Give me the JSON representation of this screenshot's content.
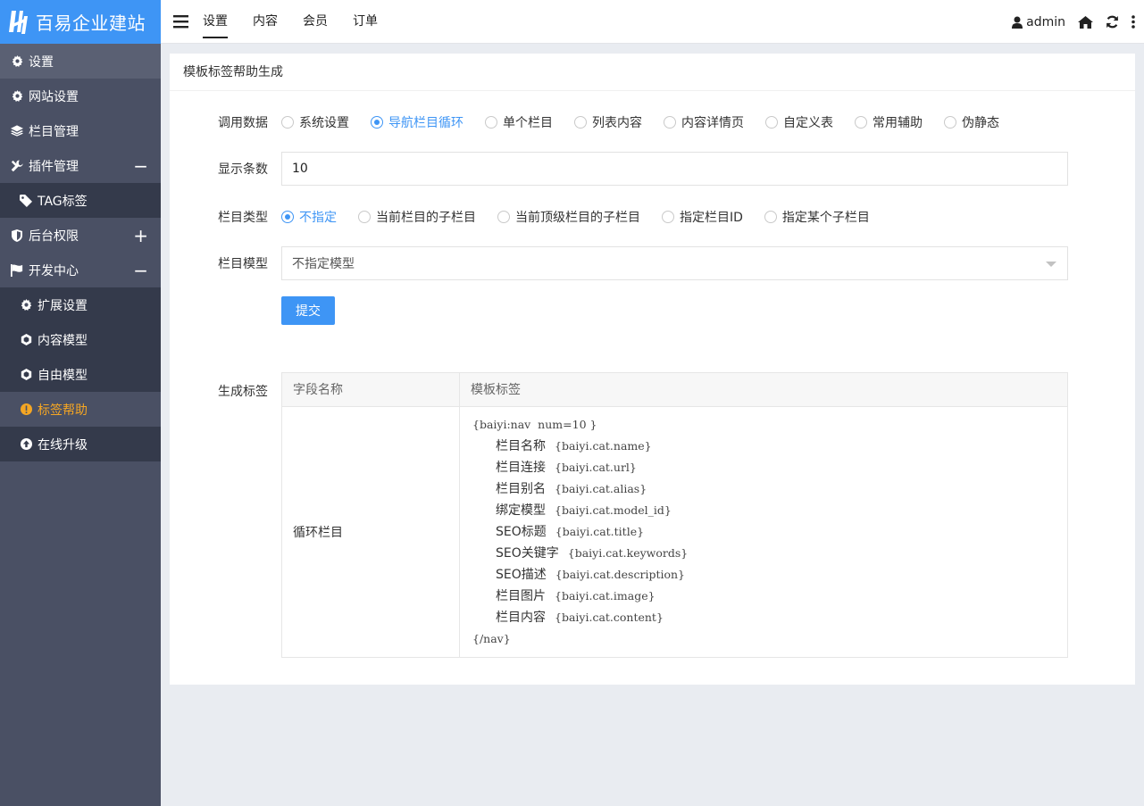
{
  "brand": {
    "name": "百易企业建站"
  },
  "sidebar": {
    "items": [
      {
        "label": "设置",
        "icon": "gear-icon",
        "type": "head"
      },
      {
        "label": "网站设置",
        "icon": "gear-icon",
        "type": "top"
      },
      {
        "label": "栏目管理",
        "icon": "layers-icon",
        "type": "top"
      },
      {
        "label": "插件管理",
        "icon": "tools-icon",
        "type": "top",
        "toggle": "−"
      },
      {
        "label": "TAG标签",
        "icon": "tag-icon",
        "type": "sub"
      },
      {
        "label": "后台权限",
        "icon": "shield-icon",
        "type": "top",
        "toggle": "+"
      },
      {
        "label": "开发中心",
        "icon": "flag-icon",
        "type": "top",
        "toggle": "−"
      },
      {
        "label": "扩展设置",
        "icon": "gear-icon",
        "type": "sub"
      },
      {
        "label": "内容模型",
        "icon": "cube-icon",
        "type": "sub"
      },
      {
        "label": "自由模型",
        "icon": "cube-icon",
        "type": "sub"
      },
      {
        "label": "标签帮助",
        "icon": "alert-icon",
        "type": "sub",
        "active": true
      },
      {
        "label": "在线升级",
        "icon": "upload-icon",
        "type": "sub"
      }
    ]
  },
  "header": {
    "tabs": [
      "设置",
      "内容",
      "会员",
      "订单"
    ],
    "active_tab": "设置",
    "user": "admin"
  },
  "panel": {
    "title": "模板标签帮助生成",
    "data_source": {
      "label": "调用数据",
      "options": [
        "系统设置",
        "导航栏目循环",
        "单个栏目",
        "列表内容",
        "内容详情页",
        "自定义表",
        "常用辅助",
        "伪静态"
      ],
      "selected": "导航栏目循环"
    },
    "count": {
      "label": "显示条数",
      "value": "10"
    },
    "category_type": {
      "label": "栏目类型",
      "options": [
        "不指定",
        "当前栏目的子栏目",
        "当前顶级栏目的子栏目",
        "指定栏目ID",
        "指定某个子栏目"
      ],
      "selected": "不指定"
    },
    "category_model": {
      "label": "栏目模型",
      "value": "不指定模型"
    },
    "submit_label": "提交",
    "result": {
      "label": "生成标签",
      "col1": "字段名称",
      "col2": "模板标签",
      "row_name": "循环栏目",
      "open_tag": "{baiyi:nav  num=10 }",
      "fields": [
        {
          "name": "栏目名称",
          "tag": "{baiyi.cat.name}"
        },
        {
          "name": "栏目连接",
          "tag": "{baiyi.cat.url}"
        },
        {
          "name": "栏目别名",
          "tag": "{baiyi.cat.alias}"
        },
        {
          "name": "绑定模型",
          "tag": "{baiyi.cat.model_id}"
        },
        {
          "name": "SEO标题",
          "tag": "{baiyi.cat.title}"
        },
        {
          "name": "SEO关键字",
          "tag": "{baiyi.cat.keywords}"
        },
        {
          "name": "SEO描述",
          "tag": "{baiyi.cat.description}"
        },
        {
          "name": "栏目图片",
          "tag": "{baiyi.cat.image}"
        },
        {
          "name": "栏目内容",
          "tag": "{baiyi.cat.content}"
        }
      ],
      "close_tag": "{/nav}"
    }
  },
  "colors": {
    "accent": "#3e95f5",
    "sidebar": "#4a5064",
    "sidebar_sub": "#343a4b",
    "active_text": "#f5a623"
  }
}
